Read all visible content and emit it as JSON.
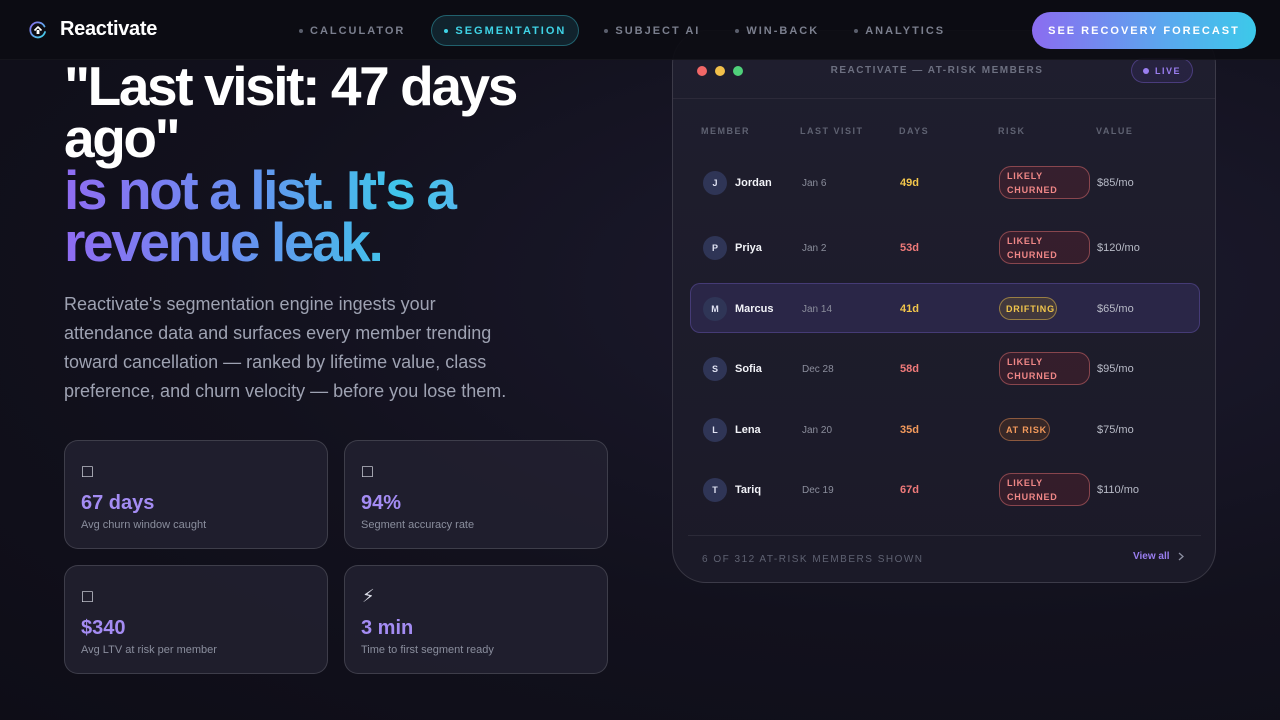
{
  "brand": {
    "name": "Reactivate",
    "logo_icon": "logo-icon"
  },
  "nav": {
    "links": [
      {
        "label": "CALCULATOR",
        "active": false
      },
      {
        "label": "SEGMENTATION",
        "active": true
      },
      {
        "label": "SUBJECT AI",
        "active": false
      },
      {
        "label": "WIN-BACK",
        "active": false
      },
      {
        "label": "ANALYTICS",
        "active": false
      }
    ],
    "cta_label": "SEE RECOVERY FORECAST"
  },
  "hero": {
    "title_line_1": "\"Last visit: 47 days",
    "title_line_2": "ago\"",
    "title_line_3": "is not a list. It's a",
    "title_line_4": "revenue leak.",
    "description": "Reactivate's segmentation engine ingests your attendance data and surfaces every member trending toward cancellation — ranked by lifetime value, class preference, and churn velocity — before you lose them."
  },
  "stats": [
    {
      "icon": "□",
      "value": "67 days",
      "label": "Avg churn window caught"
    },
    {
      "icon": "□",
      "value": "94%",
      "label": "Segment accuracy rate"
    },
    {
      "icon": "□",
      "value": "$340",
      "label": "Avg LTV at risk per member"
    },
    {
      "icon": "⚡",
      "value": "3 min",
      "label": "Time to first segment ready"
    }
  ],
  "panel": {
    "title": "REACTIVATE — AT-RISK MEMBERS",
    "live_label": "LIVE",
    "columns": {
      "member": "MEMBER",
      "last_visit": "LAST VISIT",
      "days": "DAYS",
      "risk": "RISK",
      "value": "VALUE"
    },
    "rows": [
      {
        "initial": "J",
        "name": "Jordan",
        "last_visit": "Jan 6",
        "days": "49d",
        "days_color": "#f2c64b",
        "risk_line_1": "LIKELY",
        "risk_line_2": "CHURNED",
        "value": "$85/mo"
      },
      {
        "initial": "P",
        "name": "Priya",
        "last_visit": "Jan 2",
        "days": "53d",
        "days_color": "#f07a7a",
        "risk_line_1": "LIKELY",
        "risk_line_2": "CHURNED",
        "value": "$120/mo"
      },
      {
        "initial": "M",
        "name": "Marcus",
        "last_visit": "Jan 14",
        "days": "41d",
        "days_color": "#f2c64b",
        "risk_line_1": "DRIFTING",
        "risk_line_2": "",
        "value": "$65/mo"
      },
      {
        "initial": "S",
        "name": "Sofia",
        "last_visit": "Dec 28",
        "days": "58d",
        "days_color": "#f07a7a",
        "risk_line_1": "LIKELY",
        "risk_line_2": "CHURNED",
        "value": "$95/mo"
      },
      {
        "initial": "L",
        "name": "Lena",
        "last_visit": "Jan 20",
        "days": "35d",
        "days_color": "#f39a5c",
        "risk_line_1": "AT RISK",
        "risk_line_2": "",
        "value": "$75/mo"
      },
      {
        "initial": "T",
        "name": "Tariq",
        "last_visit": "Dec 19",
        "days": "67d",
        "days_color": "#f07a7a",
        "risk_line_1": "LIKELY",
        "risk_line_2": "CHURNED",
        "value": "$110/mo"
      }
    ],
    "footer_count": "6 OF 312 AT-RISK MEMBERS SHOWN",
    "view_all_label": "View all"
  },
  "colors": {
    "accent_purple": "#8b6cf0",
    "accent_cyan": "#3fd3e6",
    "win_dot_red": "#f16767",
    "win_dot_yellow": "#f2c04a",
    "win_dot_green": "#4fd07a"
  }
}
